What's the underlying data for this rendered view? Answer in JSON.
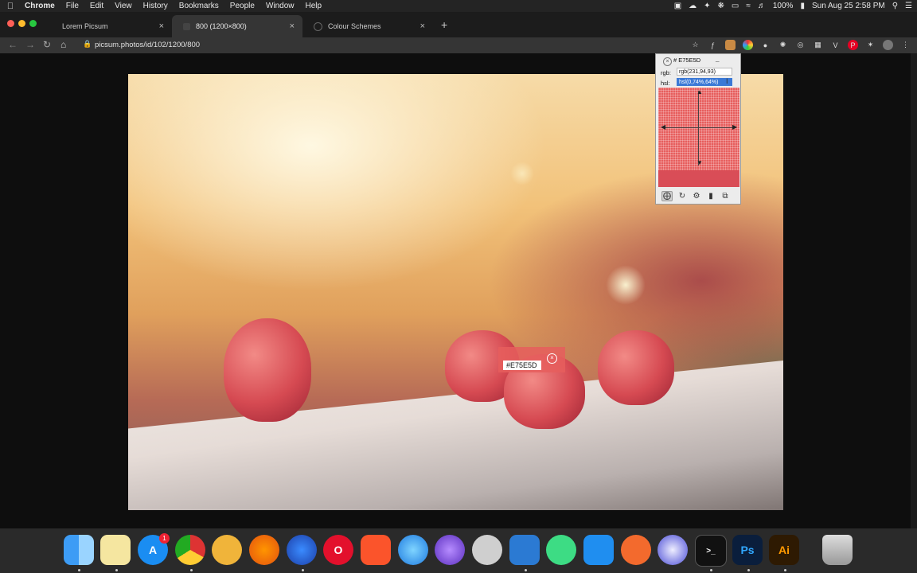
{
  "menubar": {
    "app_name": "Chrome",
    "items": [
      "File",
      "Edit",
      "View",
      "History",
      "Bookmarks",
      "People",
      "Window",
      "Help"
    ],
    "battery": "100%",
    "clock": "Sun Aug 25  2:58 PM"
  },
  "tabs": [
    {
      "title": "Lorem Picsum",
      "active": false
    },
    {
      "title": "800 (1200×800)",
      "active": true
    },
    {
      "title": "Colour Schemes",
      "active": false
    }
  ],
  "toolbar": {
    "url": "picsum.photos/id/102/1200/800"
  },
  "picker": {
    "hex": "# E75E5D",
    "rgb_label": "rgb:",
    "rgb_value": "rgb(231,94,93)",
    "hsl_label": "hsl:",
    "hsl_value": "hsl(0,74%,64%)",
    "swatch_color": "#e75e5d"
  },
  "image_tooltip": {
    "hex_value": "#E75E5D"
  },
  "dock": {
    "appstore_badge": "1",
    "items": [
      "finder-icon",
      "notes-icon",
      "app-store-icon",
      "chrome-icon",
      "chrome-canary-icon",
      "firefox-icon",
      "firefox-dev-icon",
      "opera-icon",
      "brave-icon",
      "safari-icon",
      "safari-preview-icon",
      "tool-icon",
      "vscode-icon",
      "android-studio-icon",
      "xcode-icon",
      "pen-icon",
      "app-icon",
      "terminal-icon",
      "photoshop-icon",
      "illustrator-icon",
      "trash-icon"
    ],
    "ps_label": "Ps",
    "ai_label": "Ai"
  }
}
